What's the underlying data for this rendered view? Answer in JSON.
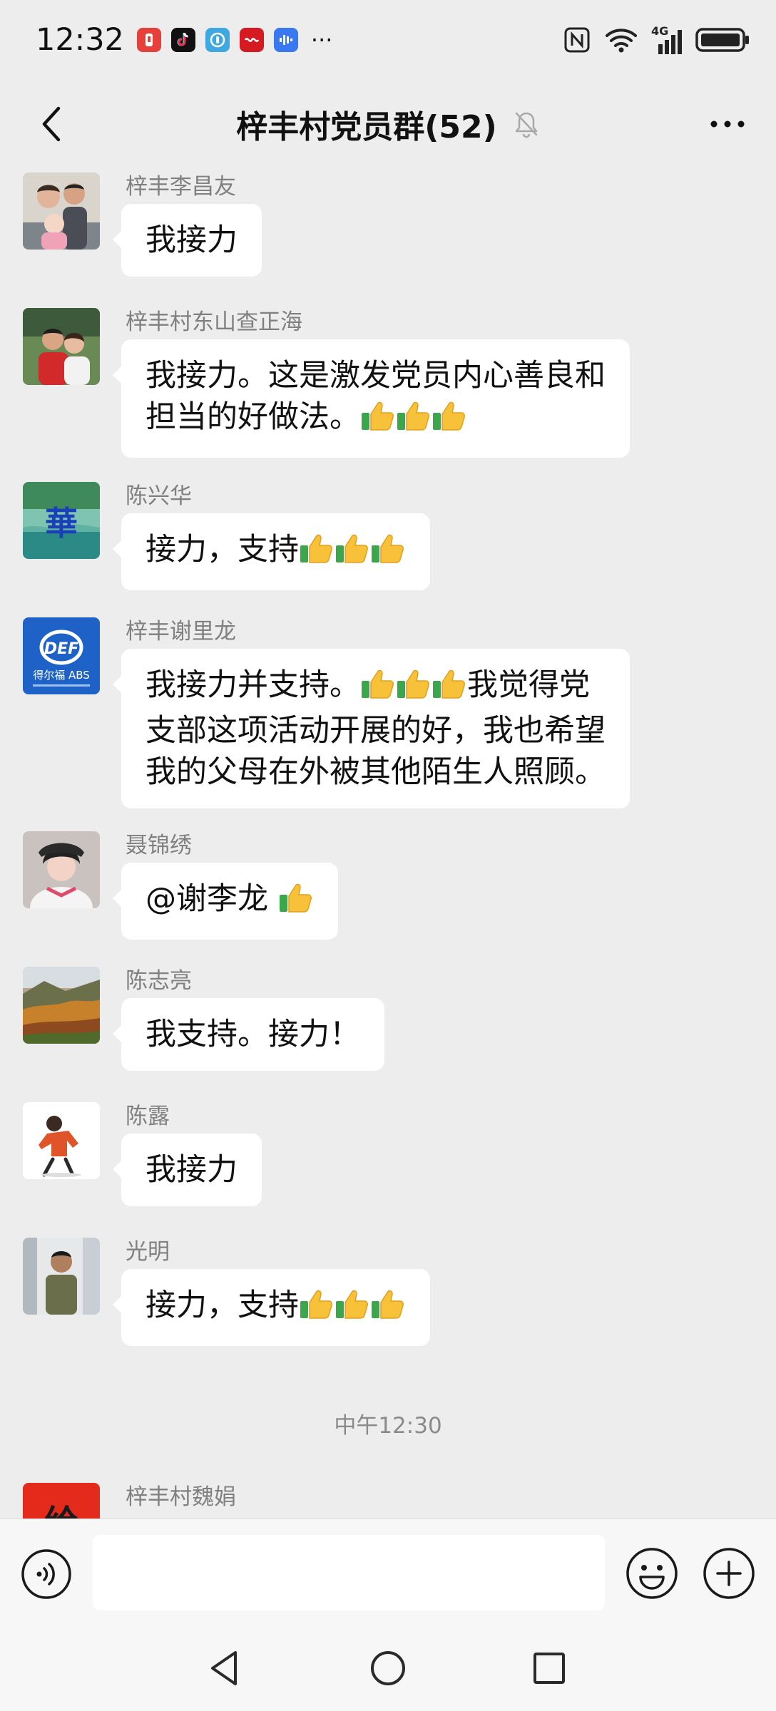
{
  "status_bar": {
    "time": "12:32",
    "notification_icons": [
      "notification-red-icon",
      "tiktok-icon",
      "browser-icon",
      "news-icon",
      "audio-app-icon"
    ],
    "more": "···",
    "network_label": "4G"
  },
  "header": {
    "title": "梓丰村党员群(52)",
    "muted": true
  },
  "messages": [
    {
      "sender": "梓丰李昌友",
      "lines": [
        "我接力"
      ],
      "thumbs": 0
    },
    {
      "sender": "梓丰村东山查正海",
      "lines": [
        "我接力。这是激发党员内心善良和",
        "担当的好做法。"
      ],
      "thumbs": 3
    },
    {
      "sender": "陈兴华",
      "lines": [
        "接力，支持"
      ],
      "thumbs": 3
    },
    {
      "sender": "梓丰谢里龙",
      "lines": [
        "我接力并支持。",
        "我觉得党",
        "支部这项活动开展的好，我也希望",
        "我的父母在外被其他陌生人照顾。"
      ],
      "thumbs": 3
    },
    {
      "sender": "聂锦绣",
      "lines": [
        "@谢李龙 "
      ],
      "thumbs": 1
    },
    {
      "sender": "陈志亮",
      "lines": [
        "我支持。接力！"
      ],
      "thumbs": 0
    },
    {
      "sender": "陈露",
      "lines": [
        "我接力"
      ],
      "thumbs": 0
    },
    {
      "sender": "光明",
      "lines": [
        "接力，支持"
      ],
      "thumbs": 3
    },
    {
      "sender": "梓丰村魏娟",
      "lines": [],
      "thumbs": 0
    }
  ],
  "avatars": {
    "chenxinghua_text": "華",
    "xielilong_brand": "得尔福 ABS",
    "xielilong_logo": "DEF",
    "weijuan_text": "给"
  },
  "time_divider": "中午12:30",
  "input": {
    "value": "",
    "placeholder": ""
  },
  "colors": {
    "background": "#ededed",
    "bubble": "#ffffff",
    "sender": "#808080",
    "input_bar": "#f7f7f7"
  }
}
